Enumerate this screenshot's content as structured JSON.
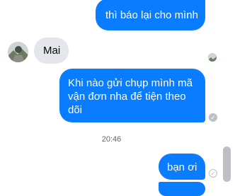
{
  "messages": [
    {
      "text": "thì báo lại cho mình",
      "direction": "outgoing"
    },
    {
      "text": "Mai",
      "direction": "incoming"
    },
    {
      "text": "Khi nào gửi chụp mình mã vận đơn nha để tiện theo dõi",
      "direction": "outgoing",
      "status": "seen"
    },
    {
      "text": "bạn ơi",
      "direction": "outgoing",
      "status": "sent"
    }
  ],
  "timestamp": "20:46",
  "colors": {
    "outgoing_bubble": "#0a7cff",
    "incoming_bubble": "#e4e6eb",
    "status_icon": "#bcc0c4"
  }
}
